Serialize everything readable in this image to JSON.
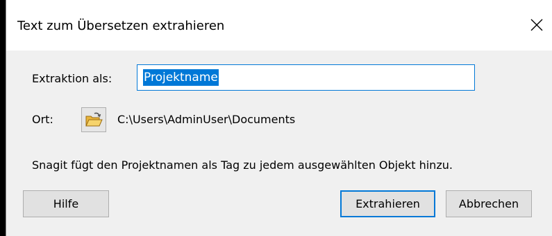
{
  "dialog": {
    "title": "Text zum Übersetzen extrahieren",
    "close_icon": "close-x-icon"
  },
  "form": {
    "extraction_label": "Extraktion als:",
    "extraction_value": "Projektname",
    "location_label": "Ort:",
    "folder_icon": "open-folder-icon",
    "location_path": "C:\\Users\\AdminUser\\Documents",
    "info_text": "Snagit fügt den Projektnamen als Tag zu jedem ausgewählten Objekt hinzu."
  },
  "buttons": {
    "help": "Hilfe",
    "extract": "Extrahieren",
    "cancel": "Abbrechen"
  },
  "colors": {
    "accent": "#0078d7",
    "dialog_bg": "#f0f0f0",
    "titlebar_bg": "#ffffff"
  }
}
